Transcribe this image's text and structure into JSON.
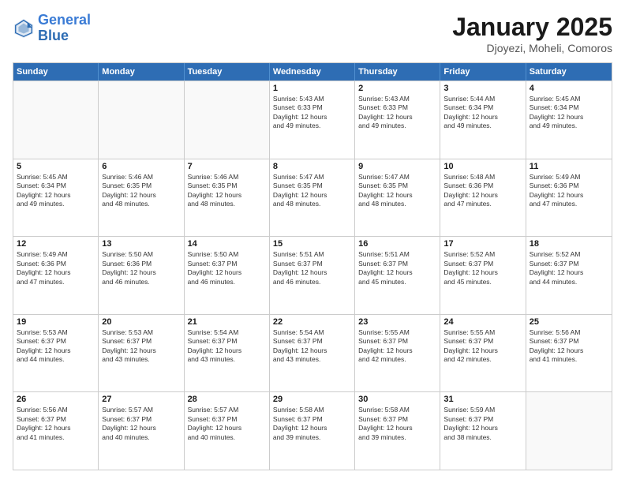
{
  "header": {
    "logo_line1": "General",
    "logo_line2": "Blue",
    "month": "January 2025",
    "location": "Djoyezi, Moheli, Comoros"
  },
  "days_of_week": [
    "Sunday",
    "Monday",
    "Tuesday",
    "Wednesday",
    "Thursday",
    "Friday",
    "Saturday"
  ],
  "weeks": [
    [
      {
        "day": "",
        "info": ""
      },
      {
        "day": "",
        "info": ""
      },
      {
        "day": "",
        "info": ""
      },
      {
        "day": "1",
        "info": "Sunrise: 5:43 AM\nSunset: 6:33 PM\nDaylight: 12 hours\nand 49 minutes."
      },
      {
        "day": "2",
        "info": "Sunrise: 5:43 AM\nSunset: 6:33 PM\nDaylight: 12 hours\nand 49 minutes."
      },
      {
        "day": "3",
        "info": "Sunrise: 5:44 AM\nSunset: 6:34 PM\nDaylight: 12 hours\nand 49 minutes."
      },
      {
        "day": "4",
        "info": "Sunrise: 5:45 AM\nSunset: 6:34 PM\nDaylight: 12 hours\nand 49 minutes."
      }
    ],
    [
      {
        "day": "5",
        "info": "Sunrise: 5:45 AM\nSunset: 6:34 PM\nDaylight: 12 hours\nand 49 minutes."
      },
      {
        "day": "6",
        "info": "Sunrise: 5:46 AM\nSunset: 6:35 PM\nDaylight: 12 hours\nand 48 minutes."
      },
      {
        "day": "7",
        "info": "Sunrise: 5:46 AM\nSunset: 6:35 PM\nDaylight: 12 hours\nand 48 minutes."
      },
      {
        "day": "8",
        "info": "Sunrise: 5:47 AM\nSunset: 6:35 PM\nDaylight: 12 hours\nand 48 minutes."
      },
      {
        "day": "9",
        "info": "Sunrise: 5:47 AM\nSunset: 6:35 PM\nDaylight: 12 hours\nand 48 minutes."
      },
      {
        "day": "10",
        "info": "Sunrise: 5:48 AM\nSunset: 6:36 PM\nDaylight: 12 hours\nand 47 minutes."
      },
      {
        "day": "11",
        "info": "Sunrise: 5:49 AM\nSunset: 6:36 PM\nDaylight: 12 hours\nand 47 minutes."
      }
    ],
    [
      {
        "day": "12",
        "info": "Sunrise: 5:49 AM\nSunset: 6:36 PM\nDaylight: 12 hours\nand 47 minutes."
      },
      {
        "day": "13",
        "info": "Sunrise: 5:50 AM\nSunset: 6:36 PM\nDaylight: 12 hours\nand 46 minutes."
      },
      {
        "day": "14",
        "info": "Sunrise: 5:50 AM\nSunset: 6:37 PM\nDaylight: 12 hours\nand 46 minutes."
      },
      {
        "day": "15",
        "info": "Sunrise: 5:51 AM\nSunset: 6:37 PM\nDaylight: 12 hours\nand 46 minutes."
      },
      {
        "day": "16",
        "info": "Sunrise: 5:51 AM\nSunset: 6:37 PM\nDaylight: 12 hours\nand 45 minutes."
      },
      {
        "day": "17",
        "info": "Sunrise: 5:52 AM\nSunset: 6:37 PM\nDaylight: 12 hours\nand 45 minutes."
      },
      {
        "day": "18",
        "info": "Sunrise: 5:52 AM\nSunset: 6:37 PM\nDaylight: 12 hours\nand 44 minutes."
      }
    ],
    [
      {
        "day": "19",
        "info": "Sunrise: 5:53 AM\nSunset: 6:37 PM\nDaylight: 12 hours\nand 44 minutes."
      },
      {
        "day": "20",
        "info": "Sunrise: 5:53 AM\nSunset: 6:37 PM\nDaylight: 12 hours\nand 43 minutes."
      },
      {
        "day": "21",
        "info": "Sunrise: 5:54 AM\nSunset: 6:37 PM\nDaylight: 12 hours\nand 43 minutes."
      },
      {
        "day": "22",
        "info": "Sunrise: 5:54 AM\nSunset: 6:37 PM\nDaylight: 12 hours\nand 43 minutes."
      },
      {
        "day": "23",
        "info": "Sunrise: 5:55 AM\nSunset: 6:37 PM\nDaylight: 12 hours\nand 42 minutes."
      },
      {
        "day": "24",
        "info": "Sunrise: 5:55 AM\nSunset: 6:37 PM\nDaylight: 12 hours\nand 42 minutes."
      },
      {
        "day": "25",
        "info": "Sunrise: 5:56 AM\nSunset: 6:37 PM\nDaylight: 12 hours\nand 41 minutes."
      }
    ],
    [
      {
        "day": "26",
        "info": "Sunrise: 5:56 AM\nSunset: 6:37 PM\nDaylight: 12 hours\nand 41 minutes."
      },
      {
        "day": "27",
        "info": "Sunrise: 5:57 AM\nSunset: 6:37 PM\nDaylight: 12 hours\nand 40 minutes."
      },
      {
        "day": "28",
        "info": "Sunrise: 5:57 AM\nSunset: 6:37 PM\nDaylight: 12 hours\nand 40 minutes."
      },
      {
        "day": "29",
        "info": "Sunrise: 5:58 AM\nSunset: 6:37 PM\nDaylight: 12 hours\nand 39 minutes."
      },
      {
        "day": "30",
        "info": "Sunrise: 5:58 AM\nSunset: 6:37 PM\nDaylight: 12 hours\nand 39 minutes."
      },
      {
        "day": "31",
        "info": "Sunrise: 5:59 AM\nSunset: 6:37 PM\nDaylight: 12 hours\nand 38 minutes."
      },
      {
        "day": "",
        "info": ""
      }
    ]
  ]
}
